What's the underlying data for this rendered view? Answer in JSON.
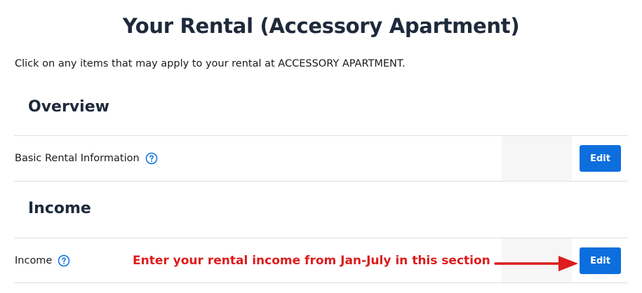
{
  "page": {
    "title": "Your Rental (Accessory Apartment)",
    "intro": "Click on any items that may apply to your rental at ACCESSORY APARTMENT."
  },
  "sections": [
    {
      "heading": "Overview",
      "rows": [
        {
          "label": "Basic Rental Information",
          "help_icon": "question-circle-icon",
          "button": "Edit"
        }
      ]
    },
    {
      "heading": "Income",
      "rows": [
        {
          "label": "Income",
          "help_icon": "question-circle-icon",
          "button": "Edit"
        }
      ]
    }
  ],
  "annotation": {
    "text": "Enter your rental income from Jan-July in this section",
    "color": "#dd1c1c"
  },
  "colors": {
    "accent": "#0d6edd",
    "heading": "#1e2a3b"
  }
}
